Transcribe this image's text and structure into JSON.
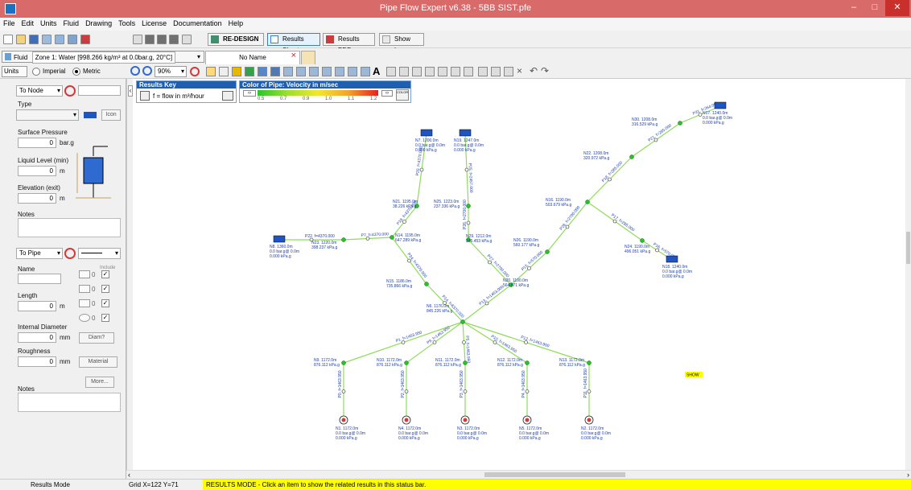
{
  "window": {
    "title": "Pipe Flow Expert v6.38 - 5BB SIST.pfe",
    "minimize": "–",
    "maximize": "□",
    "close": "✕"
  },
  "menu": [
    "File",
    "Edit",
    "Units",
    "Fluid",
    "Drawing",
    "Tools",
    "License",
    "Documentation",
    "Help"
  ],
  "toolbar": {
    "redesign": "RE-DESIGN",
    "results_sheet": "Results Sheet",
    "results_pdf": "Results PDF",
    "show_log": "Show Log"
  },
  "fluid_bar": {
    "fluid_label": "Fluid",
    "fluid_value": "Zone 1: Water [998.266 kg/m³ at 0.0bar.g, 20°C]",
    "tab_name": "No Name",
    "tab_close": "×"
  },
  "units_bar": {
    "units_label": "Units",
    "imperial": "Imperial",
    "metric": "Metric",
    "zoom": "90%"
  },
  "node_panel": {
    "node_select": "To Node",
    "type_label": "Type",
    "icon_button": "Icon",
    "surface_pressure_label": "Surface Pressure",
    "surface_pressure_value": "0",
    "surface_pressure_unit": "bar.g",
    "liquid_level_label": "Liquid Level (min)",
    "liquid_level_value": "0",
    "liquid_level_unit": "m",
    "elevation_label": "Elevation (exit)",
    "elevation_value": "0",
    "elevation_unit": "m",
    "notes_label": "Notes"
  },
  "pipe_panel": {
    "pipe_select": "To Pipe",
    "name_label": "Name",
    "include_label": "Include",
    "length_label": "Length",
    "length_value": "0",
    "length_unit": "m",
    "include_counts": [
      "0",
      "0",
      "0",
      "0"
    ],
    "internal_diameter_label": "Internal Diameter",
    "internal_diameter_value": "0",
    "internal_diameter_unit": "mm",
    "diam_button": "Diam?",
    "roughness_label": "Roughness",
    "roughness_value": "0",
    "roughness_unit": "mm",
    "material_button": "Material",
    "more_button": "More...",
    "notes_label": "Notes"
  },
  "results_key": {
    "title": "Results Key",
    "description": "f = flow in m³/hour"
  },
  "color_key": {
    "title": "Color of Pipe: Velocity in m/sec",
    "ticks": [
      "0.5",
      "0.7",
      "0.9",
      "1.0",
      "1.1",
      "1.2"
    ],
    "color_button": "COLOR"
  },
  "status_bar": {
    "mode": "Results Mode",
    "grid": "Grid X=122 Y=71",
    "message": "RESULTS MODE - Click an item to show the related results in this status bar."
  },
  "drawing": {
    "show_badge": "SHOW",
    "nodes": [
      {
        "name": "N17",
        "lines": [
          "N17. 1240.0m",
          "0.0 bar.g@ 0.0m",
          "0.000 kPa.g"
        ]
      },
      {
        "name": "N30",
        "lines": [
          "N30. 1208.0m",
          "316.529 kPa.g"
        ]
      },
      {
        "name": "N22",
        "lines": [
          "N22. 1208.0m",
          "320.972 kPa.g"
        ]
      },
      {
        "name": "N16",
        "lines": [
          "N16. 1190.0m",
          "503.679 kPa.g"
        ]
      },
      {
        "name": "N24",
        "lines": [
          "N24. 1190.0m",
          "496.051 kPa.g"
        ]
      },
      {
        "name": "N18",
        "lines": [
          "N18. 1240.0m",
          "0.0 bar.g@ 0.0m",
          "0.000 kPa.g"
        ]
      },
      {
        "name": "N7",
        "lines": [
          "N7. 1200.0m",
          "0.0 bar.g@ 0.0m",
          "0.000 kPa.g"
        ]
      },
      {
        "name": "N19",
        "lines": [
          "N19. 1247.0m",
          "0.0 bar.g@ 0.0m",
          "0.000 kPa.g"
        ]
      },
      {
        "name": "N21",
        "lines": [
          "N21. 1195.0m",
          "38.226 kPa.g"
        ]
      },
      {
        "name": "N25",
        "lines": [
          "N25. 1223.0m",
          "237.336 kPa.g"
        ]
      },
      {
        "name": "N29",
        "lines": [
          "N29. 1212.0m",
          "346.453 kPa.g"
        ]
      },
      {
        "name": "N26",
        "lines": [
          "N26. 1190.0m",
          "560.177 kPa.g"
        ]
      },
      {
        "name": "N14",
        "lines": [
          "N14. 1195.0m",
          "647.289 kPa.g"
        ]
      },
      {
        "name": "N23",
        "lines": [
          "N23. 1220.0m",
          "398.237 kPa.g"
        ]
      },
      {
        "name": "N8",
        "lines": [
          "N8. 1360.0m",
          "0.0 bar.g@ 0.0m",
          "0.000 kPa.g"
        ]
      },
      {
        "name": "N15",
        "lines": [
          "N15. 1186.0m",
          "735.866 kPa.g"
        ]
      },
      {
        "name": "N20",
        "lines": [
          "N20. 1190.0m",
          "564.871 kPa.g"
        ]
      },
      {
        "name": "N6",
        "lines": [
          "N6. 1176.0m",
          "845.226 kPa.g"
        ]
      },
      {
        "name": "N9",
        "lines": [
          "N9. 1172.0m",
          "876.112 kPa.g"
        ]
      },
      {
        "name": "N10",
        "lines": [
          "N10. 1172.0m",
          "876.112 kPa.g"
        ]
      },
      {
        "name": "N11",
        "lines": [
          "N11. 1172.0m",
          "876.112 kPa.g"
        ]
      },
      {
        "name": "N12",
        "lines": [
          "N12. 1172.0m",
          "876.112 kPa.g"
        ]
      },
      {
        "name": "N13",
        "lines": [
          "N13. 1172.0m",
          "876.112 kPa.g"
        ]
      },
      {
        "name": "N1",
        "lines": [
          "N1. 1172.0m",
          "0.0 bar.g@ 0.0m",
          "0.000 kPa.g"
        ]
      },
      {
        "name": "N4",
        "lines": [
          "N4. 1172.0m",
          "0.0 bar.g@ 0.0m",
          "0.000 kPa.g"
        ]
      },
      {
        "name": "N3",
        "lines": [
          "N3. 1172.0m",
          "0.0 bar.g@ 0.0m",
          "0.000 kPa.g"
        ]
      },
      {
        "name": "N5",
        "lines": [
          "N5. 1172.0m",
          "0.0 bar.g@ 0.0m",
          "0.000 kPa.g"
        ]
      },
      {
        "name": "N2",
        "lines": [
          "N2. 1172.0m",
          "0.0 bar.g@ 0.0m",
          "0.000 kPa.g"
        ]
      }
    ],
    "pipes": [
      {
        "name": "P31",
        "label": "P31. f=264.000"
      },
      {
        "name": "P21",
        "label": "P21. f=285.000"
      },
      {
        "name": "P18",
        "label": "P18. f=285.000"
      },
      {
        "name": "P17",
        "label": "P17. f=285.000"
      },
      {
        "name": "P25",
        "label": "P25. f=2457.000"
      },
      {
        "name": "P20",
        "label": "P20. f=4370.000"
      },
      {
        "name": "P26",
        "label": "P26. f=2700.000"
      },
      {
        "name": "P27",
        "label": "P27. f=2700.000"
      },
      {
        "name": "P28",
        "label": "P28. f=2700.000"
      },
      {
        "name": "P16",
        "label": "P16. f=570.000"
      },
      {
        "name": "P15",
        "label": "P15. f=570.000"
      },
      {
        "name": "P22",
        "label": "P22. f=4370.000"
      },
      {
        "name": "P7",
        "label": "P7. f=4370.000"
      },
      {
        "name": "P19",
        "label": "P19. f=4370.000"
      },
      {
        "name": "P24",
        "label": "P24. f=4370.000"
      },
      {
        "name": "P14",
        "label": "P14. f=6370.000"
      },
      {
        "name": "P13",
        "label": "P13. f=1463.000"
      },
      {
        "name": "P1",
        "label": "P1. f=1463.950"
      },
      {
        "name": "P9",
        "label": "P9. f=1463.950"
      },
      {
        "name": "P10",
        "label": "P10. f=1463.950"
      },
      {
        "name": "P12",
        "label": "P12. f=1463.950"
      },
      {
        "name": "P5",
        "label": "P5. f=1463.950"
      },
      {
        "name": "P0",
        "label": "P0. f=1463.950"
      },
      {
        "name": "P2",
        "label": "P2. f=1463.950"
      },
      {
        "name": "P3",
        "label": "P3. f=1463.950"
      },
      {
        "name": "P4",
        "label": "P4. f=1463.950"
      },
      {
        "name": "P11",
        "label": "P11. f=1463.950"
      }
    ]
  },
  "colors": {
    "pipe": "#8fdc5a",
    "node": "#27c427",
    "tank": "#1f55c2",
    "pump": "#d03a3a",
    "label": "#1b3fae",
    "titlebar": "#d86a6a",
    "status_yellow": "#ffff00"
  }
}
